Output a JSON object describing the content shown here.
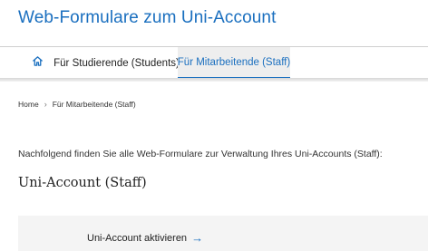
{
  "header": {
    "title": "Web-Formulare zum Uni-Account"
  },
  "nav": {
    "home_icon": "home-icon",
    "items": [
      {
        "label": "Für Studierende (Students)"
      },
      {
        "label": "Für Mitarbeitende (Staff)",
        "active": true
      }
    ],
    "accent_color": "#1a6fbf"
  },
  "breadcrumb": {
    "home": "Home",
    "separator": "›",
    "current": "Für Mitarbeitende (Staff)"
  },
  "main": {
    "intro": "Nachfolgend finden Sie alle Web-Formulare zur Verwaltung Ihres Uni-Accounts (Staff):",
    "section_title": "Uni-Account (Staff)",
    "cards": [
      {
        "label": "Uni-Account aktivieren",
        "arrow": "→"
      }
    ]
  }
}
